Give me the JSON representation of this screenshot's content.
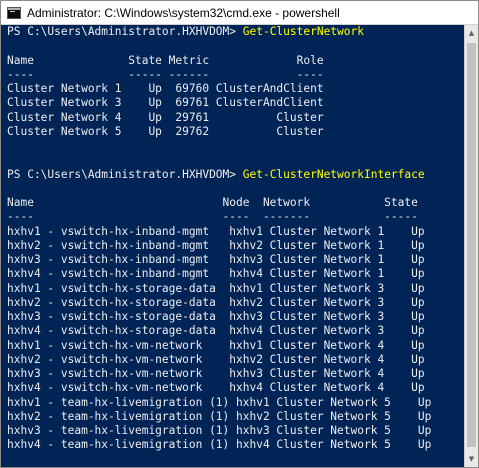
{
  "window": {
    "title": "Administrator: C:\\Windows\\system32\\cmd.exe - powershell",
    "app_icon": "cmd-icon"
  },
  "console": {
    "lines": [
      {
        "prompt": "PS C:\\Users\\Administrator.HXHVDOM> ",
        "command": "Get-ClusterNetwork"
      },
      {
        "text": ""
      },
      {
        "text": "Name              State Metric             Role"
      },
      {
        "text": "----              ----- ------             ----"
      },
      {
        "text": "Cluster Network 1    Up  69760 ClusterAndClient"
      },
      {
        "text": "Cluster Network 3    Up  69761 ClusterAndClient"
      },
      {
        "text": "Cluster Network 4    Up  29761          Cluster"
      },
      {
        "text": "Cluster Network 5    Up  29762          Cluster"
      },
      {
        "text": ""
      },
      {
        "text": ""
      },
      {
        "prompt": "PS C:\\Users\\Administrator.HXHVDOM> ",
        "command": "Get-ClusterNetworkInterface"
      },
      {
        "text": ""
      },
      {
        "text": "Name                            Node  Network           State"
      },
      {
        "text": "----                            ----  -------           -----"
      },
      {
        "text": "hxhv1 - vswitch-hx-inband-mgmt   hxhv1 Cluster Network 1    Up"
      },
      {
        "text": "hxhv2 - vswitch-hx-inband-mgmt   hxhv2 Cluster Network 1    Up"
      },
      {
        "text": "hxhv3 - vswitch-hx-inband-mgmt   hxhv3 Cluster Network 1    Up"
      },
      {
        "text": "hxhv4 - vswitch-hx-inband-mgmt   hxhv4 Cluster Network 1    Up"
      },
      {
        "text": "hxhv1 - vswitch-hx-storage-data  hxhv1 Cluster Network 3    Up"
      },
      {
        "text": "hxhv2 - vswitch-hx-storage-data  hxhv2 Cluster Network 3    Up"
      },
      {
        "text": "hxhv3 - vswitch-hx-storage-data  hxhv3 Cluster Network 3    Up"
      },
      {
        "text": "hxhv4 - vswitch-hx-storage-data  hxhv4 Cluster Network 3    Up"
      },
      {
        "text": "hxhv1 - vswitch-hx-vm-network    hxhv1 Cluster Network 4    Up"
      },
      {
        "text": "hxhv2 - vswitch-hx-vm-network    hxhv2 Cluster Network 4    Up"
      },
      {
        "text": "hxhv3 - vswitch-hx-vm-network    hxhv3 Cluster Network 4    Up"
      },
      {
        "text": "hxhv4 - vswitch-hx-vm-network    hxhv4 Cluster Network 4    Up"
      },
      {
        "text": "hxhv1 - team-hx-livemigration (1) hxhv1 Cluster Network 5    Up"
      },
      {
        "text": "hxhv2 - team-hx-livemigration (1) hxhv2 Cluster Network 5    Up"
      },
      {
        "text": "hxhv3 - team-hx-livemigration (1) hxhv3 Cluster Network 5    Up"
      },
      {
        "text": "hxhv4 - team-hx-livemigration (1) hxhv4 Cluster Network 5    Up"
      }
    ]
  },
  "colors": {
    "console_bg": "#012456",
    "console_text": "#eeedf0",
    "command_text": "#ffff00"
  }
}
